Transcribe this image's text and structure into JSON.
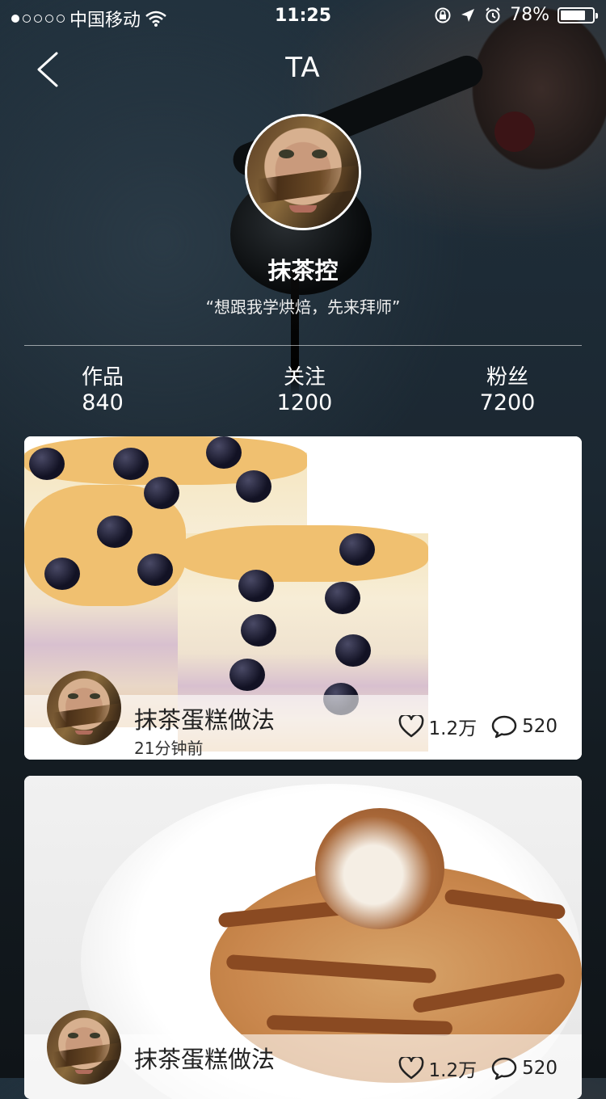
{
  "status_bar": {
    "carrier": "中国移动",
    "time": "11:25",
    "battery": "78%",
    "battery_level": 0.78
  },
  "nav": {
    "title": "TA",
    "back_icon": "chevron-left-icon"
  },
  "profile": {
    "name": "抹茶控",
    "bio": "“想跟我学烘焙，先来拜师”"
  },
  "stats": [
    {
      "label": "作品",
      "value": "840"
    },
    {
      "label": "关注",
      "value": "1200"
    },
    {
      "label": "粉丝",
      "value": "7200"
    }
  ],
  "posts": [
    {
      "title": "抹茶蛋糕做法",
      "time": "21分钟前",
      "likes": "1.2万",
      "comments": "520"
    },
    {
      "title": "抹茶蛋糕做法",
      "likes": "1.2万",
      "comments": "520"
    }
  ]
}
